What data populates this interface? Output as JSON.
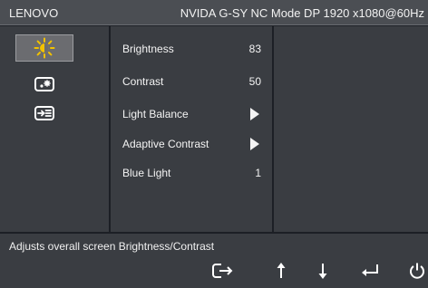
{
  "topbar": {
    "brand": "LENOVO",
    "mode": "NVIDA G-SY NC Mode DP 1920 x1080@60Hz"
  },
  "sidebar": {
    "items": [
      {
        "icon": "brightness-icon",
        "selected": true
      },
      {
        "icon": "picture-settings-icon",
        "selected": false
      },
      {
        "icon": "input-source-icon",
        "selected": false
      }
    ]
  },
  "menu": {
    "items": [
      {
        "label": "Brightness",
        "value": "83"
      },
      {
        "label": "Contrast",
        "value": "50"
      },
      {
        "label": "Light Balance",
        "value": null,
        "submenu": true
      },
      {
        "label": "Adaptive Contrast",
        "value": null,
        "submenu": true
      },
      {
        "label": "Blue Light",
        "value": "1"
      }
    ]
  },
  "help": {
    "text": "Adjusts overall screen Brightness/Contrast"
  },
  "nav": {
    "buttons": [
      "exit-icon",
      "up-arrow-icon",
      "down-arrow-icon",
      "enter-icon",
      "power-icon"
    ]
  },
  "colors": {
    "accent": "#f2c200",
    "panel": "#3a3d42",
    "topbar": "#4b4e53",
    "selected": "#6b6c70"
  }
}
